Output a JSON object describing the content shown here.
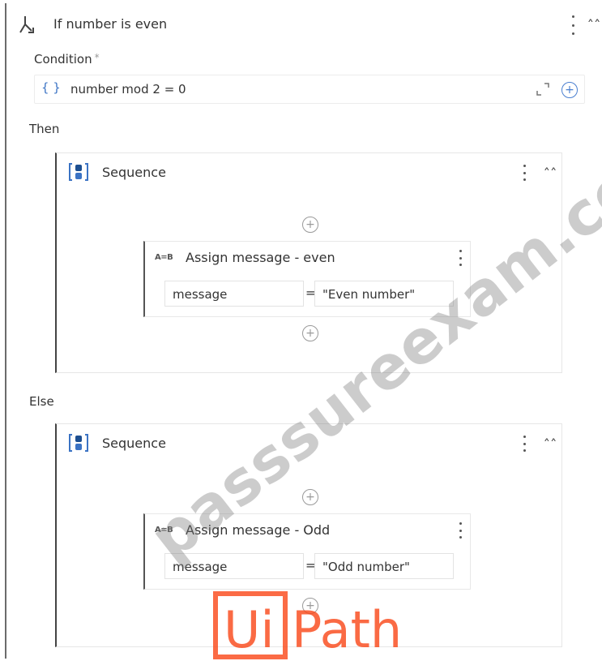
{
  "if_activity": {
    "title": "If number is even",
    "condition_label": "Condition",
    "required_marker": "*",
    "condition_expression": "number mod 2 = 0",
    "expression_glyph": "{ }"
  },
  "then_branch": {
    "label": "Then",
    "sequence": {
      "title": "Sequence",
      "assign": {
        "title": "Assign message - even",
        "to": "message",
        "equals": "=",
        "value": "\"Even number\""
      }
    }
  },
  "else_branch": {
    "label": "Else",
    "sequence": {
      "title": "Sequence",
      "assign": {
        "title": "Assign message - Odd",
        "to": "message",
        "equals": "=",
        "value": "\"Odd number\""
      }
    }
  },
  "assign_icon_text": "A=B",
  "watermark": "passsureexam.com",
  "logo": "UiPath",
  "colors": {
    "accent_blue": "#3b73c4",
    "logo_orange": "#fa4616"
  }
}
